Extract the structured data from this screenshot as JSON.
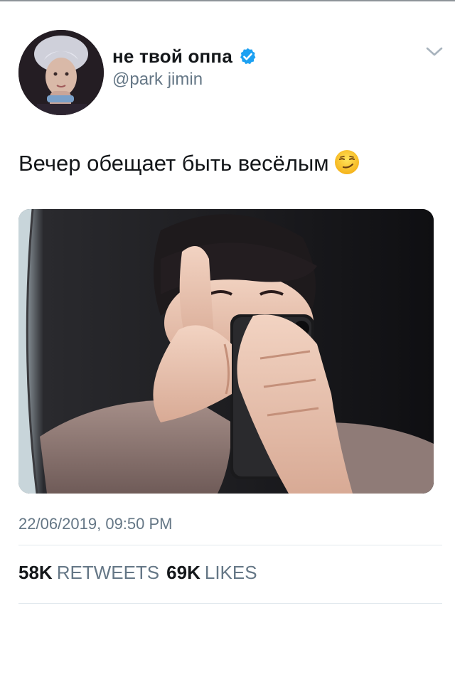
{
  "tweet": {
    "display_name": "не твой оппа",
    "handle": "@park jimin",
    "text": "Вечер обещает быть весёлым",
    "emoji": "smirking-face",
    "timestamp": "22/06/2019, 09:50 PM",
    "stats": {
      "retweets_count": "58K",
      "retweets_label": "RETWEETS",
      "likes_count": "69K",
      "likes_label": "LIKES"
    }
  },
  "colors": {
    "text_primary": "#14171a",
    "text_secondary": "#657786",
    "verified_blue": "#1da1f2",
    "divider": "#e1e8ed"
  },
  "icons": {
    "verified": "verified-badge-icon",
    "menu": "chevron-down-icon"
  }
}
